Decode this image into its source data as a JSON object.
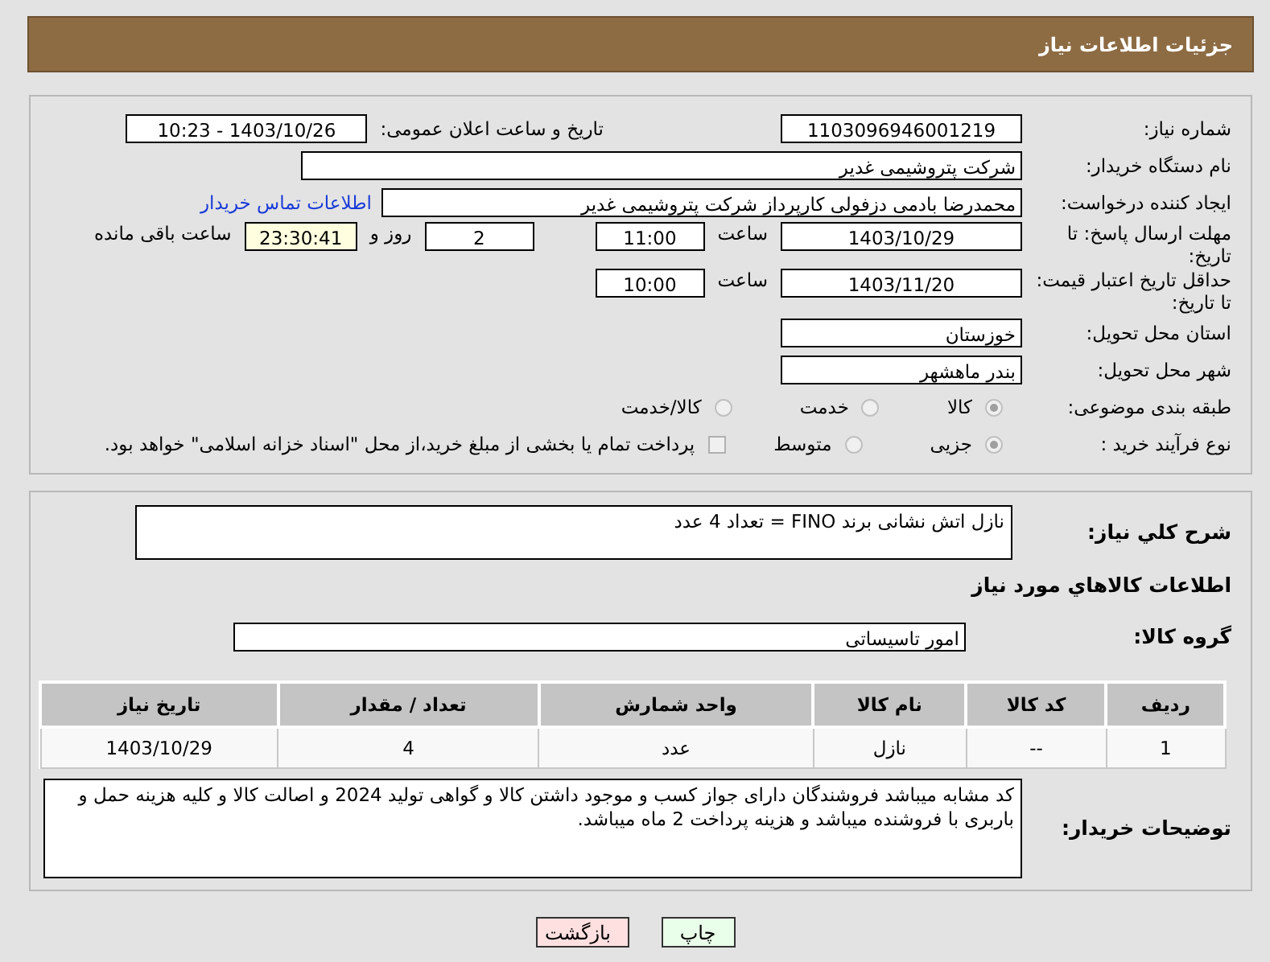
{
  "header": {
    "title": "جزئیات اطلاعات نیاز"
  },
  "need_number": {
    "label": "شماره نیاز:",
    "value": "1103096946001219"
  },
  "announce": {
    "label": "تاریخ و ساعت اعلان عمومی:",
    "value": "1403/10/26 - 10:23"
  },
  "buyer": {
    "label": "نام دستگاه خریدار:",
    "value": "شرکت پتروشیمی غدیر"
  },
  "requester": {
    "label": "ایجاد کننده درخواست:",
    "value": "محمدرضا بادمی دزفولی کارپرداز شرکت پتروشیمی غدیر",
    "link": "اطلاعات تماس خریدار"
  },
  "reply_deadline": {
    "label": "مهلت ارسال پاسخ: تا تاریخ:",
    "date": "1403/10/29",
    "time_label": "ساعت",
    "time": "11:00",
    "days": "2",
    "days_label": "روز و",
    "remaining": "23:30:41",
    "remaining_label": "ساعت باقی مانده"
  },
  "price_validity": {
    "label": "حداقل تاریخ اعتبار قیمت: تا تاریخ:",
    "date": "1403/11/20",
    "time_label": "ساعت",
    "time": "10:00"
  },
  "province": {
    "label": "استان محل تحویل:",
    "value": "خوزستان"
  },
  "city": {
    "label": "شهر محل تحویل:",
    "value": "بندر ماهشهر"
  },
  "category": {
    "label": "طبقه بندی موضوعی:",
    "options": [
      {
        "label": "کالا",
        "selected": true
      },
      {
        "label": "خدمت",
        "selected": false
      },
      {
        "label": "کالا/خدمت",
        "selected": false
      }
    ]
  },
  "purchase_process": {
    "label": "نوع فرآیند خرید :",
    "options": [
      {
        "label": "جزیی",
        "selected": true
      },
      {
        "label": "متوسط",
        "selected": false
      }
    ],
    "payment_note": {
      "checked": false,
      "text": "پرداخت تمام یا بخشی از مبلغ خرید،از محل \"اسناد خزانه اسلامی\" خواهد بود."
    }
  },
  "summary": {
    "label": "شرح کلي نياز:",
    "value": "نازل اتش نشانی برند  FINO    = تعداد 4 عدد"
  },
  "goods_title": "اطلاعات كالاهاي مورد نياز",
  "goods_group": {
    "label": "گروه کالا:",
    "value": "امور تاسیساتی"
  },
  "table": {
    "columns": [
      "ردیف",
      "کد کالا",
      "نام کالا",
      "واحد شمارش",
      "تعداد / مقدار",
      "تاریخ نیاز"
    ],
    "rows": [
      [
        "1",
        "--",
        "نازل",
        "عدد",
        "4",
        "1403/10/29"
      ]
    ]
  },
  "buyer_notes": {
    "label": "توضیحات خریدار:",
    "value": "کد مشابه میباشد فروشندگان دارای جواز کسب و موجود داشتن کالا و گواهی تولید 2024 و اصالت کالا و کلیه هزینه حمل و باربری با فروشنده میباشد و هزینه پرداخت 2 ماه میباشد."
  },
  "buttons": [
    {
      "label": "چاپ",
      "kind": "print"
    },
    {
      "label": "بازگشت",
      "kind": "back"
    }
  ]
}
